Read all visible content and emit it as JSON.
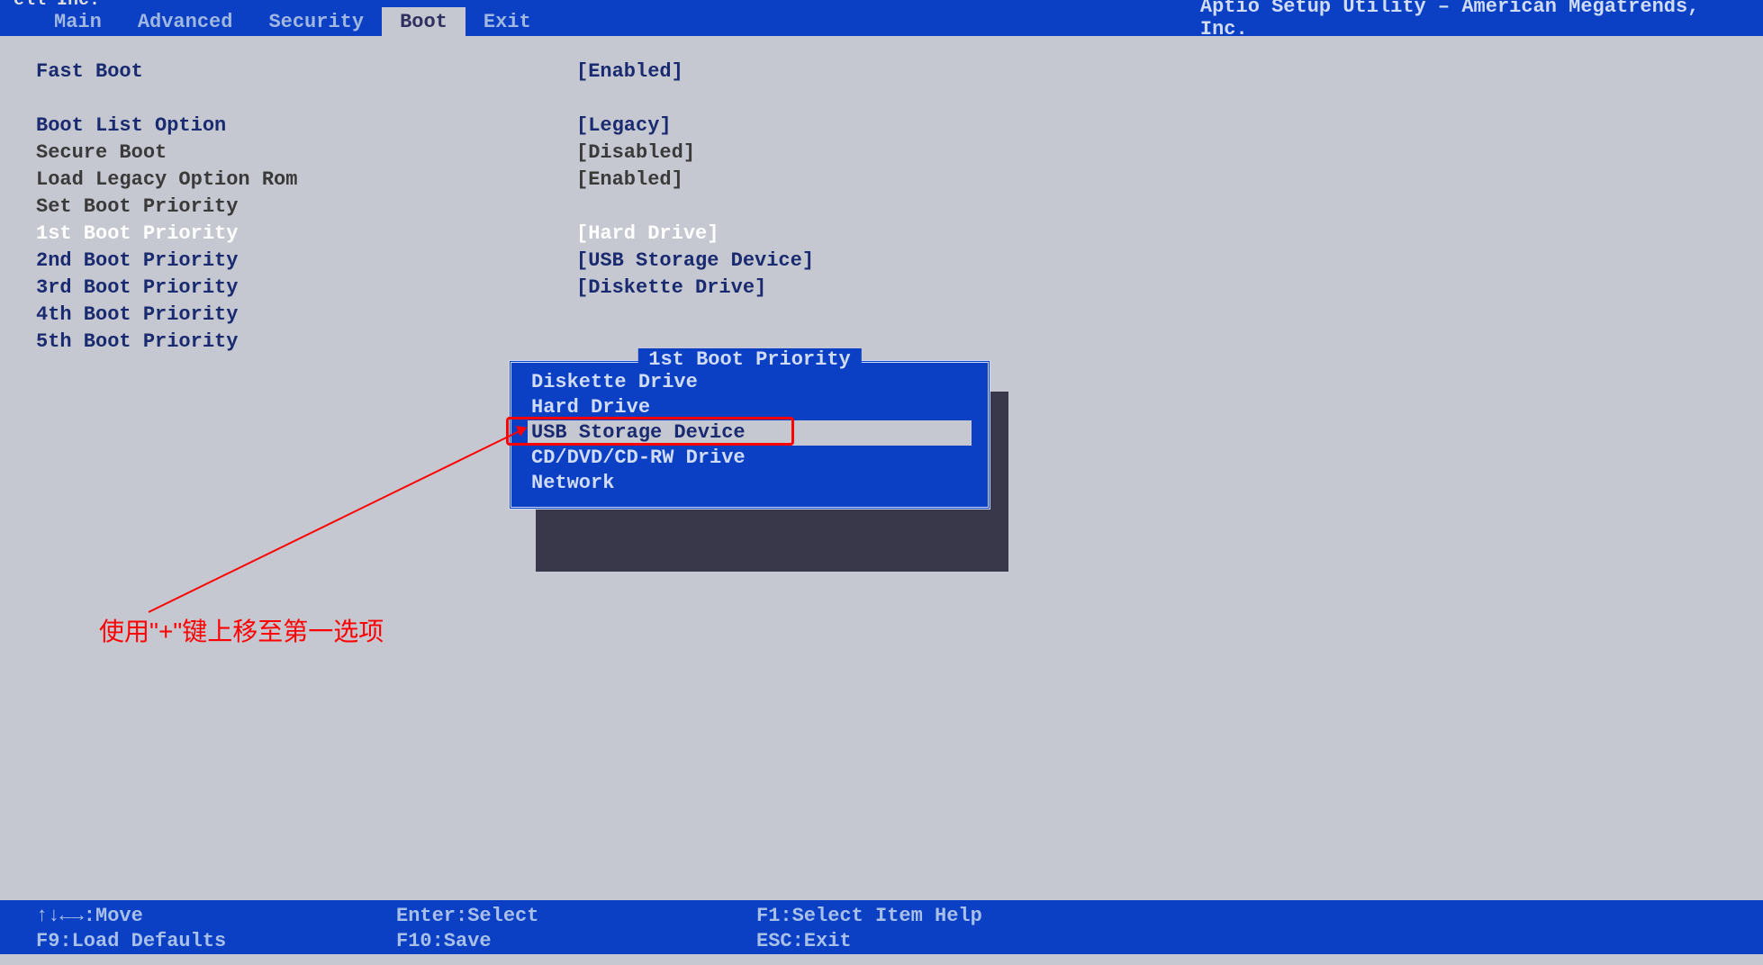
{
  "vendor": "ell Inc.",
  "utility_name": "Aptio Setup Utility – American Megatrends, Inc.",
  "tabs": [
    {
      "label": "Main"
    },
    {
      "label": "Advanced"
    },
    {
      "label": "Security"
    },
    {
      "label": "Boot"
    },
    {
      "label": "Exit"
    }
  ],
  "active_tab_index": 3,
  "rows": [
    {
      "label": "Fast Boot",
      "value": "[Enabled]",
      "style": "normal"
    },
    {
      "spacer": true
    },
    {
      "label": "Boot List Option",
      "value": "[Legacy]",
      "style": "normal"
    },
    {
      "label": "Secure Boot",
      "value": "[Disabled]",
      "style": "static"
    },
    {
      "label": "Load Legacy Option Rom",
      "value": "[Enabled]",
      "style": "static"
    },
    {
      "label": "Set Boot Priority",
      "value": "",
      "style": "static"
    },
    {
      "label": "1st Boot Priority",
      "value": "[Hard Drive]",
      "style": "highlight"
    },
    {
      "label": "2nd Boot Priority",
      "value": "[USB Storage Device]",
      "style": "normal"
    },
    {
      "label": "3rd Boot Priority",
      "value": "[Diskette Drive]",
      "style": "normal"
    },
    {
      "label": "4th Boot Priority",
      "value": "",
      "style": "normal"
    },
    {
      "label": "5th Boot Priority",
      "value": "",
      "style": "normal"
    }
  ],
  "popup": {
    "title": "1st Boot Priority",
    "items": [
      {
        "label": "Diskette Drive",
        "selected": false
      },
      {
        "label": "Hard Drive",
        "selected": false
      },
      {
        "label": "USB Storage Device",
        "selected": true
      },
      {
        "label": "CD/DVD/CD-RW Drive",
        "selected": false
      },
      {
        "label": "Network",
        "selected": false
      }
    ]
  },
  "annotation": {
    "text": "使用\"+\"键上移至第一选项"
  },
  "footer": {
    "r1c1": "↑↓←→:Move",
    "r1c2": "Enter:Select",
    "r1c3": "F1:Select Item Help",
    "r2c1": "F9:Load Defaults",
    "r2c2": "F10:Save",
    "r2c3": "ESC:Exit"
  }
}
